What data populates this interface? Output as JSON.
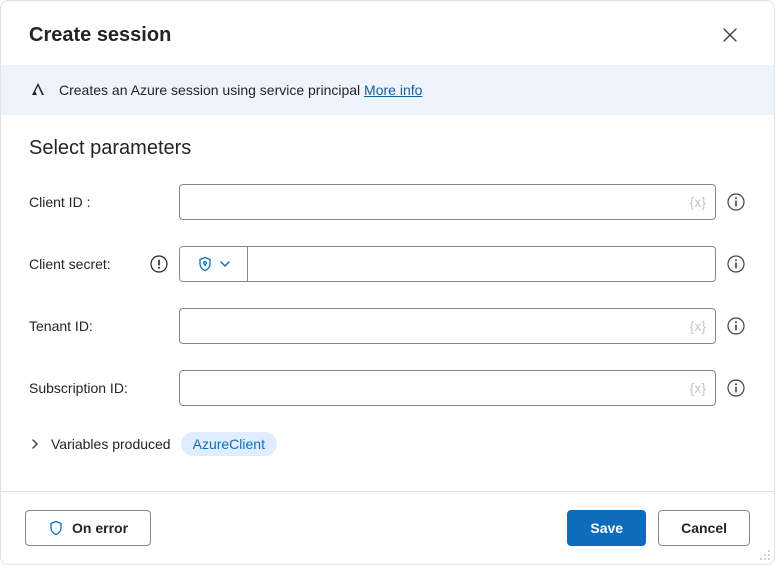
{
  "header": {
    "title": "Create session"
  },
  "banner": {
    "text": "Creates an Azure session using service principal ",
    "link": "More info"
  },
  "section": {
    "title": "Select parameters"
  },
  "fields": {
    "client_id": {
      "label": "Client ID :",
      "value": "",
      "var_hint": "{x}"
    },
    "client_secret": {
      "label": "Client secret:",
      "value": ""
    },
    "tenant_id": {
      "label": "Tenant ID:",
      "value": "",
      "var_hint": "{x}"
    },
    "subscription_id": {
      "label": "Subscription ID:",
      "value": "",
      "var_hint": "{x}"
    }
  },
  "variables": {
    "label": "Variables produced",
    "chip": "AzureClient"
  },
  "footer": {
    "on_error": "On error",
    "save": "Save",
    "cancel": "Cancel"
  }
}
